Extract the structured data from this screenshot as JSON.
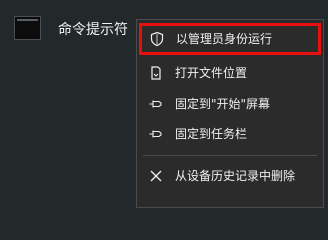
{
  "app": {
    "label": "命令提示符",
    "icon": "command-prompt-icon"
  },
  "menu": {
    "items": [
      {
        "label": "以管理员身份运行",
        "icon": "shield-icon",
        "highlighted": true
      },
      {
        "label": "打开文件位置",
        "icon": "file-location-icon"
      },
      {
        "label": "固定到\"开始\"屏幕",
        "icon": "pin-icon"
      },
      {
        "label": "固定到任务栏",
        "icon": "pin-icon"
      },
      {
        "label": "从设备历史记录中删除",
        "icon": "close-icon"
      }
    ]
  },
  "colors": {
    "background": "#23282b",
    "menu_background": "#2b2b2b",
    "highlight_border": "#e8100f",
    "text": "#f0f0f0"
  }
}
